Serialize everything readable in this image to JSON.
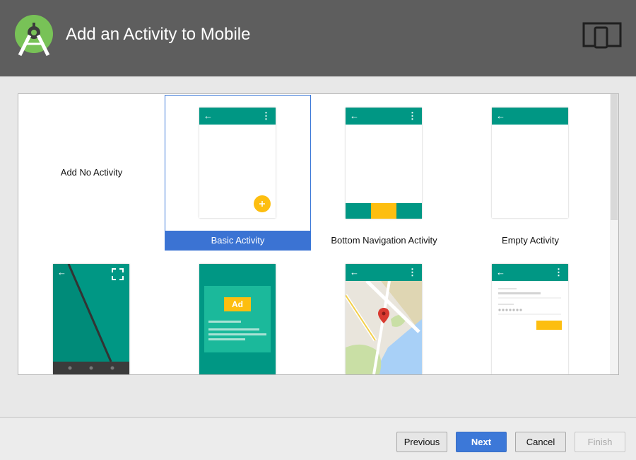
{
  "window": {
    "title": "Add an Activity to Mobile",
    "logo_icon": "android-studio-icon",
    "device_icon": "tablet-phone-icon",
    "header_color": "#5e5e5e"
  },
  "gallery": {
    "accent_color": "#009784",
    "fab_color": "#fdbe10",
    "selected_color": "#3b73d3",
    "row1": [
      {
        "label": "Add No Activity"
      },
      {
        "label": "Basic Activity",
        "selected": true
      },
      {
        "label": "Bottom Navigation Activity"
      },
      {
        "label": "Empty Activity"
      }
    ],
    "row2": [
      {
        "preview": "fullscreen-activity-preview"
      },
      {
        "preview": "ad-activity-preview",
        "badge": "Ad"
      },
      {
        "preview": "maps-activity-preview"
      },
      {
        "preview": "login-activity-preview"
      }
    ]
  },
  "footer": {
    "previous": "Previous",
    "next": "Next",
    "cancel": "Cancel",
    "finish": "Finish"
  }
}
